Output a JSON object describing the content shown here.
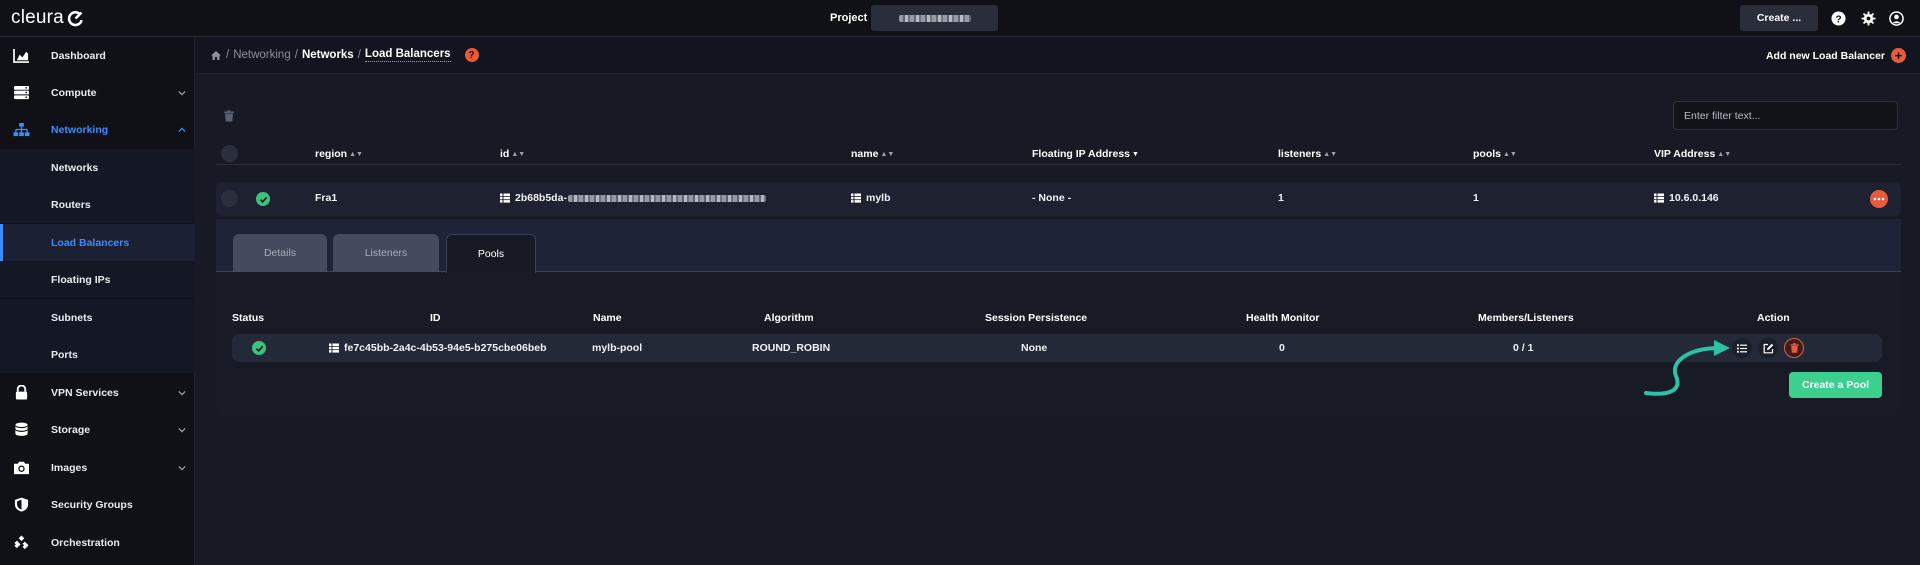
{
  "app": {
    "brand": "cleura"
  },
  "topbar": {
    "project_label": "Project",
    "create_label": "Create ..."
  },
  "sidebar": {
    "items": [
      {
        "label": "Dashboard"
      },
      {
        "label": "Compute"
      },
      {
        "label": "Networking"
      },
      {
        "label": "VPN Services"
      },
      {
        "label": "Storage"
      },
      {
        "label": "Images"
      },
      {
        "label": "Security Groups"
      },
      {
        "label": "Orchestration"
      }
    ],
    "networking_sub": [
      {
        "label": "Networks"
      },
      {
        "label": "Routers"
      },
      {
        "label": "Load Balancers"
      },
      {
        "label": "Floating IPs"
      },
      {
        "label": "Subnets"
      },
      {
        "label": "Ports"
      }
    ]
  },
  "breadcrumb": {
    "section": "Networking",
    "sub": "Networks",
    "current": "Load Balancers",
    "sep": "/"
  },
  "header": {
    "add_new_label": "Add new Load Balancer"
  },
  "filter": {
    "placeholder": "Enter filter text..."
  },
  "table": {
    "columns": [
      "region",
      "id",
      "name",
      "Floating IP Address",
      "listeners",
      "pools",
      "VIP Address"
    ],
    "row": {
      "region": "Fra1",
      "id_prefix": "2b68b5da-",
      "name": "mylb",
      "floating_ip": "- None -",
      "listeners": "1",
      "pools": "1",
      "vip": "10.6.0.146"
    }
  },
  "tabs": [
    {
      "label": "Details"
    },
    {
      "label": "Listeners"
    },
    {
      "label": "Pools"
    }
  ],
  "pools": {
    "columns": [
      "Status",
      "ID",
      "Name",
      "Algorithm",
      "Session Persistence",
      "Health Monitor",
      "Members/Listeners",
      "Action"
    ],
    "row": {
      "id": "fe7c45bb-2a4c-4b53-94e5-b275cbe06beb",
      "name": "mylb-pool",
      "algorithm": "ROUND_ROBIN",
      "session_persistence": "None",
      "health_monitor": "0",
      "members_listeners": "0 / 1"
    },
    "create_label": "Create a Pool"
  },
  "colors": {
    "accent": "#3d8bfd",
    "danger": "#e85a3b",
    "success": "#3ec27a",
    "annotation": "#2fc1a5"
  }
}
